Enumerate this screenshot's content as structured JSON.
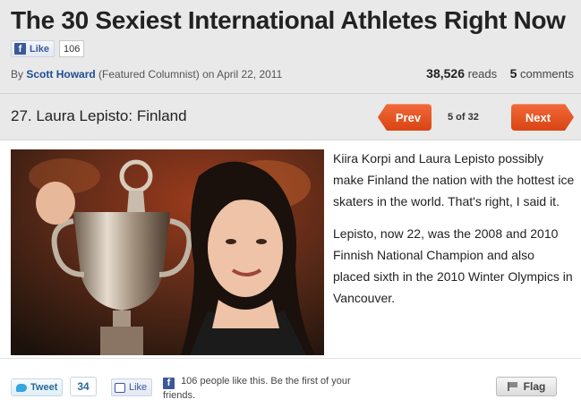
{
  "article": {
    "title": "The 30 Sexiest International Athletes Right Now",
    "like_label": "Like",
    "like_count": "106",
    "byline_prefix": "By",
    "author": "Scott Howard",
    "author_role": "(Featured Columnist) on April 22, 2011",
    "reads_count": "38,526",
    "reads_label": "reads",
    "comments_count": "5",
    "comments_label": "comments"
  },
  "slide": {
    "title": "27. Laura Lepisto: Finland",
    "prev_label": "Prev",
    "next_label": "Next",
    "counter": "5 of 32",
    "paragraphs": [
      "Kiira Korpi and Laura Lepisto possibly make Finland the nation with the hottest ice skaters in the world. That's right, I said it.",
      "Lepisto, now 22, was the 2008 and 2010 Finnish National Champion and also placed sixth in the 2010 Winter Olympics in Vancouver."
    ]
  },
  "footer": {
    "tweet_label": "Tweet",
    "tweet_count": "34",
    "like_label": "Like",
    "social_text": "106 people like this. Be the first of your friends.",
    "flag_label": "Flag"
  },
  "colors": {
    "accent_red": "#e2521f",
    "link_blue": "#1d4f91",
    "facebook_blue": "#3b5998"
  }
}
